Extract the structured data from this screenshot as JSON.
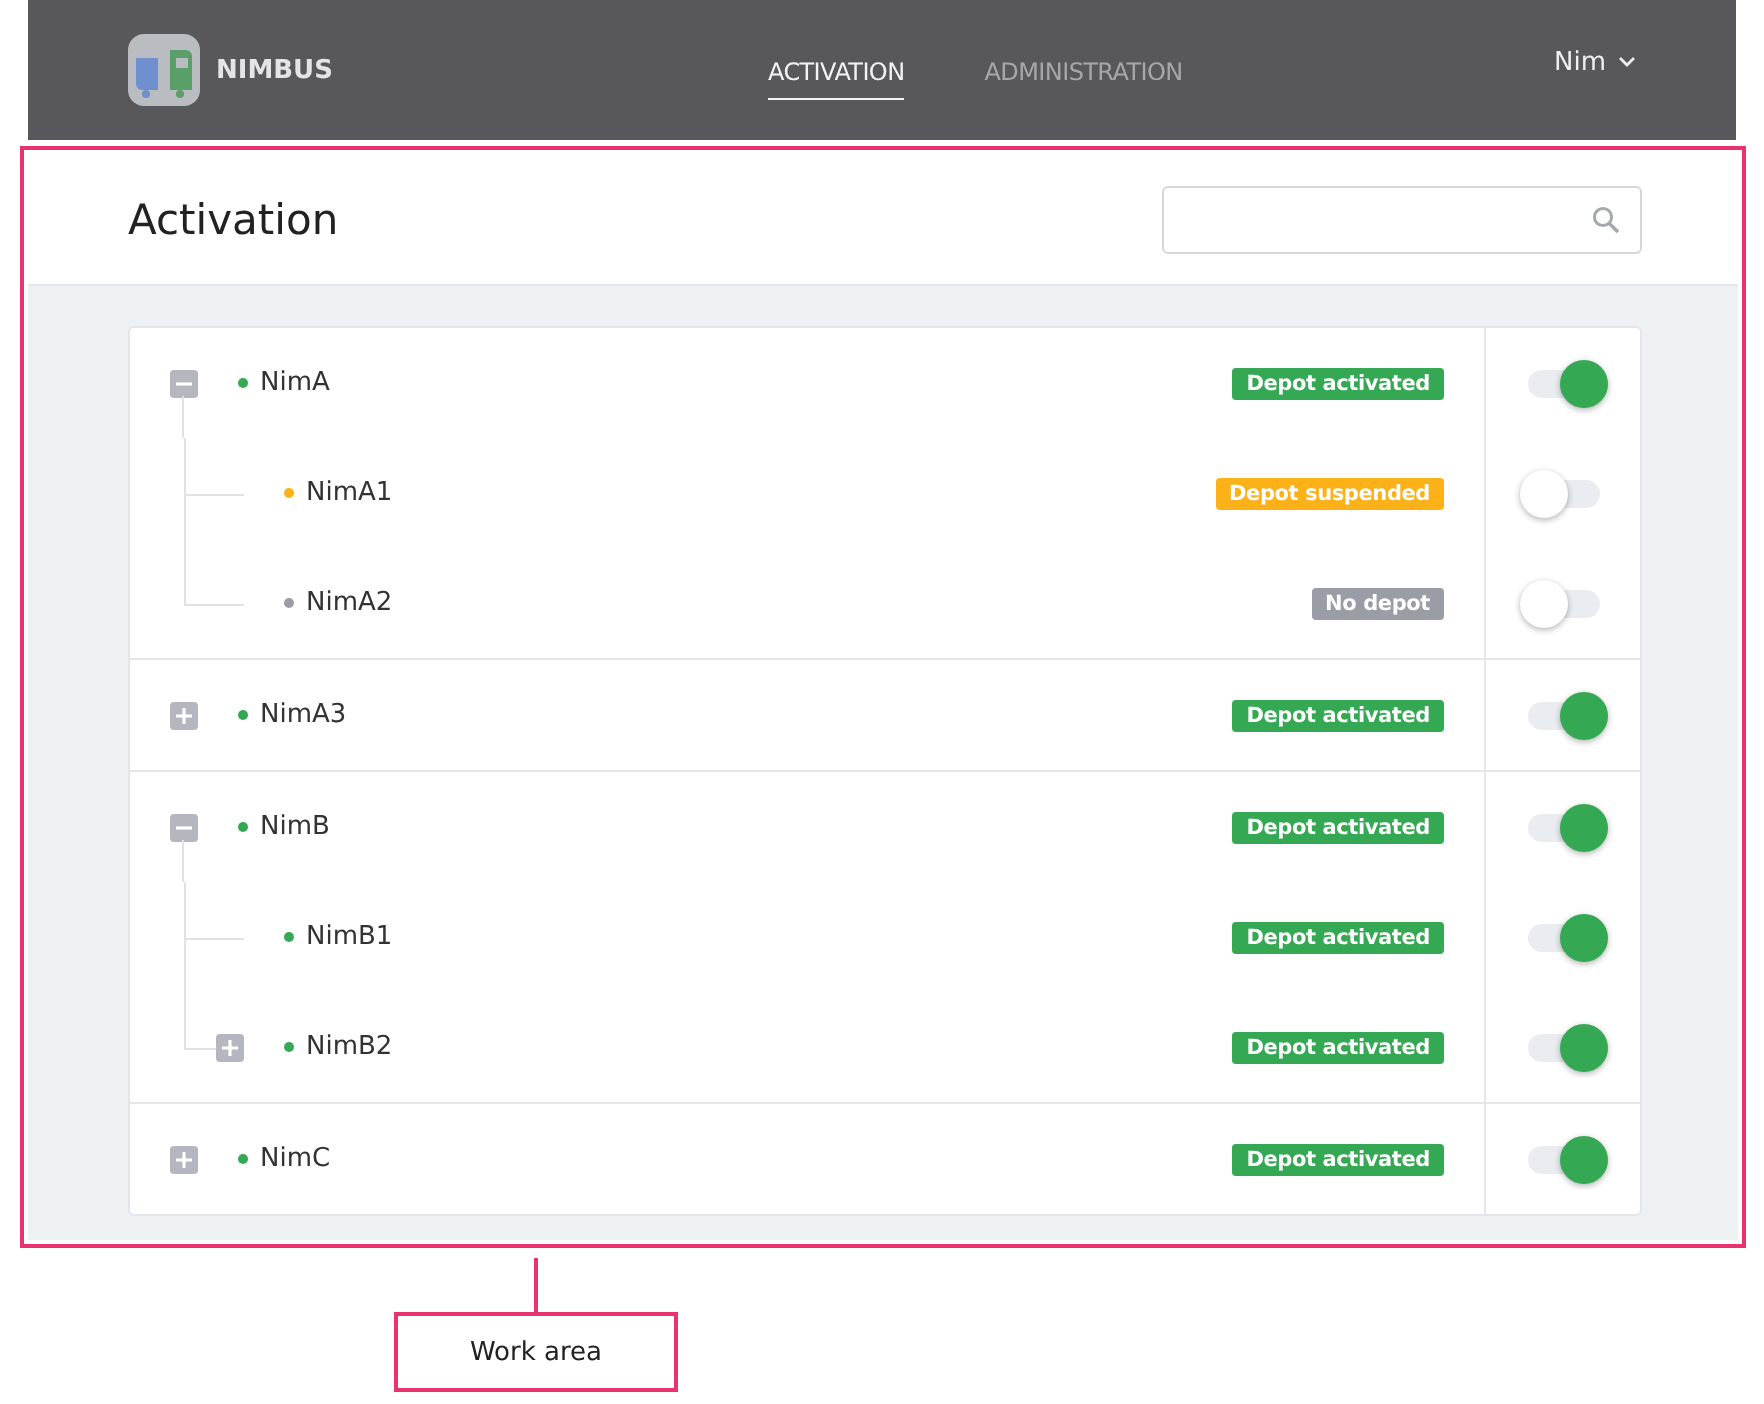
{
  "header": {
    "brand": "NIMBUS",
    "nav": [
      {
        "label": "ACTIVATION",
        "selected": true
      },
      {
        "label": "ADMINISTRATION",
        "selected": false
      }
    ],
    "user": "Nim"
  },
  "page": {
    "title": "Activation"
  },
  "groups": [
    {
      "name": "NimA",
      "expanded": true,
      "color": "#34a853",
      "badge": {
        "label": "Depot activated",
        "color": "#34a853"
      },
      "on": true,
      "children": [
        {
          "name": "NimA1",
          "color": "#fbb117",
          "badge": {
            "label": "Depot suspended",
            "color": "#fbb117"
          },
          "on": false
        },
        {
          "name": "NimA2",
          "color": "#9a9ca6",
          "badge": {
            "label": "No depot",
            "color": "#9a9ca6"
          },
          "on": false
        }
      ]
    },
    {
      "name": "NimA3",
      "expanded": false,
      "color": "#34a853",
      "badge": {
        "label": "Depot activated",
        "color": "#34a853"
      },
      "on": true
    },
    {
      "name": "NimB",
      "expanded": true,
      "color": "#34a853",
      "badge": {
        "label": "Depot activated",
        "color": "#34a853"
      },
      "on": true,
      "children": [
        {
          "name": "NimB1",
          "color": "#34a853",
          "badge": {
            "label": "Depot activated",
            "color": "#34a853"
          },
          "on": true
        },
        {
          "name": "NimB2",
          "expanded": false,
          "color": "#34a853",
          "badge": {
            "label": "Depot activated",
            "color": "#34a853"
          },
          "on": true
        }
      ]
    },
    {
      "name": "NimC",
      "expanded": false,
      "color": "#34a853",
      "badge": {
        "label": "Depot activated",
        "color": "#34a853"
      },
      "on": true
    }
  ],
  "annotation": {
    "label": "Work area"
  }
}
